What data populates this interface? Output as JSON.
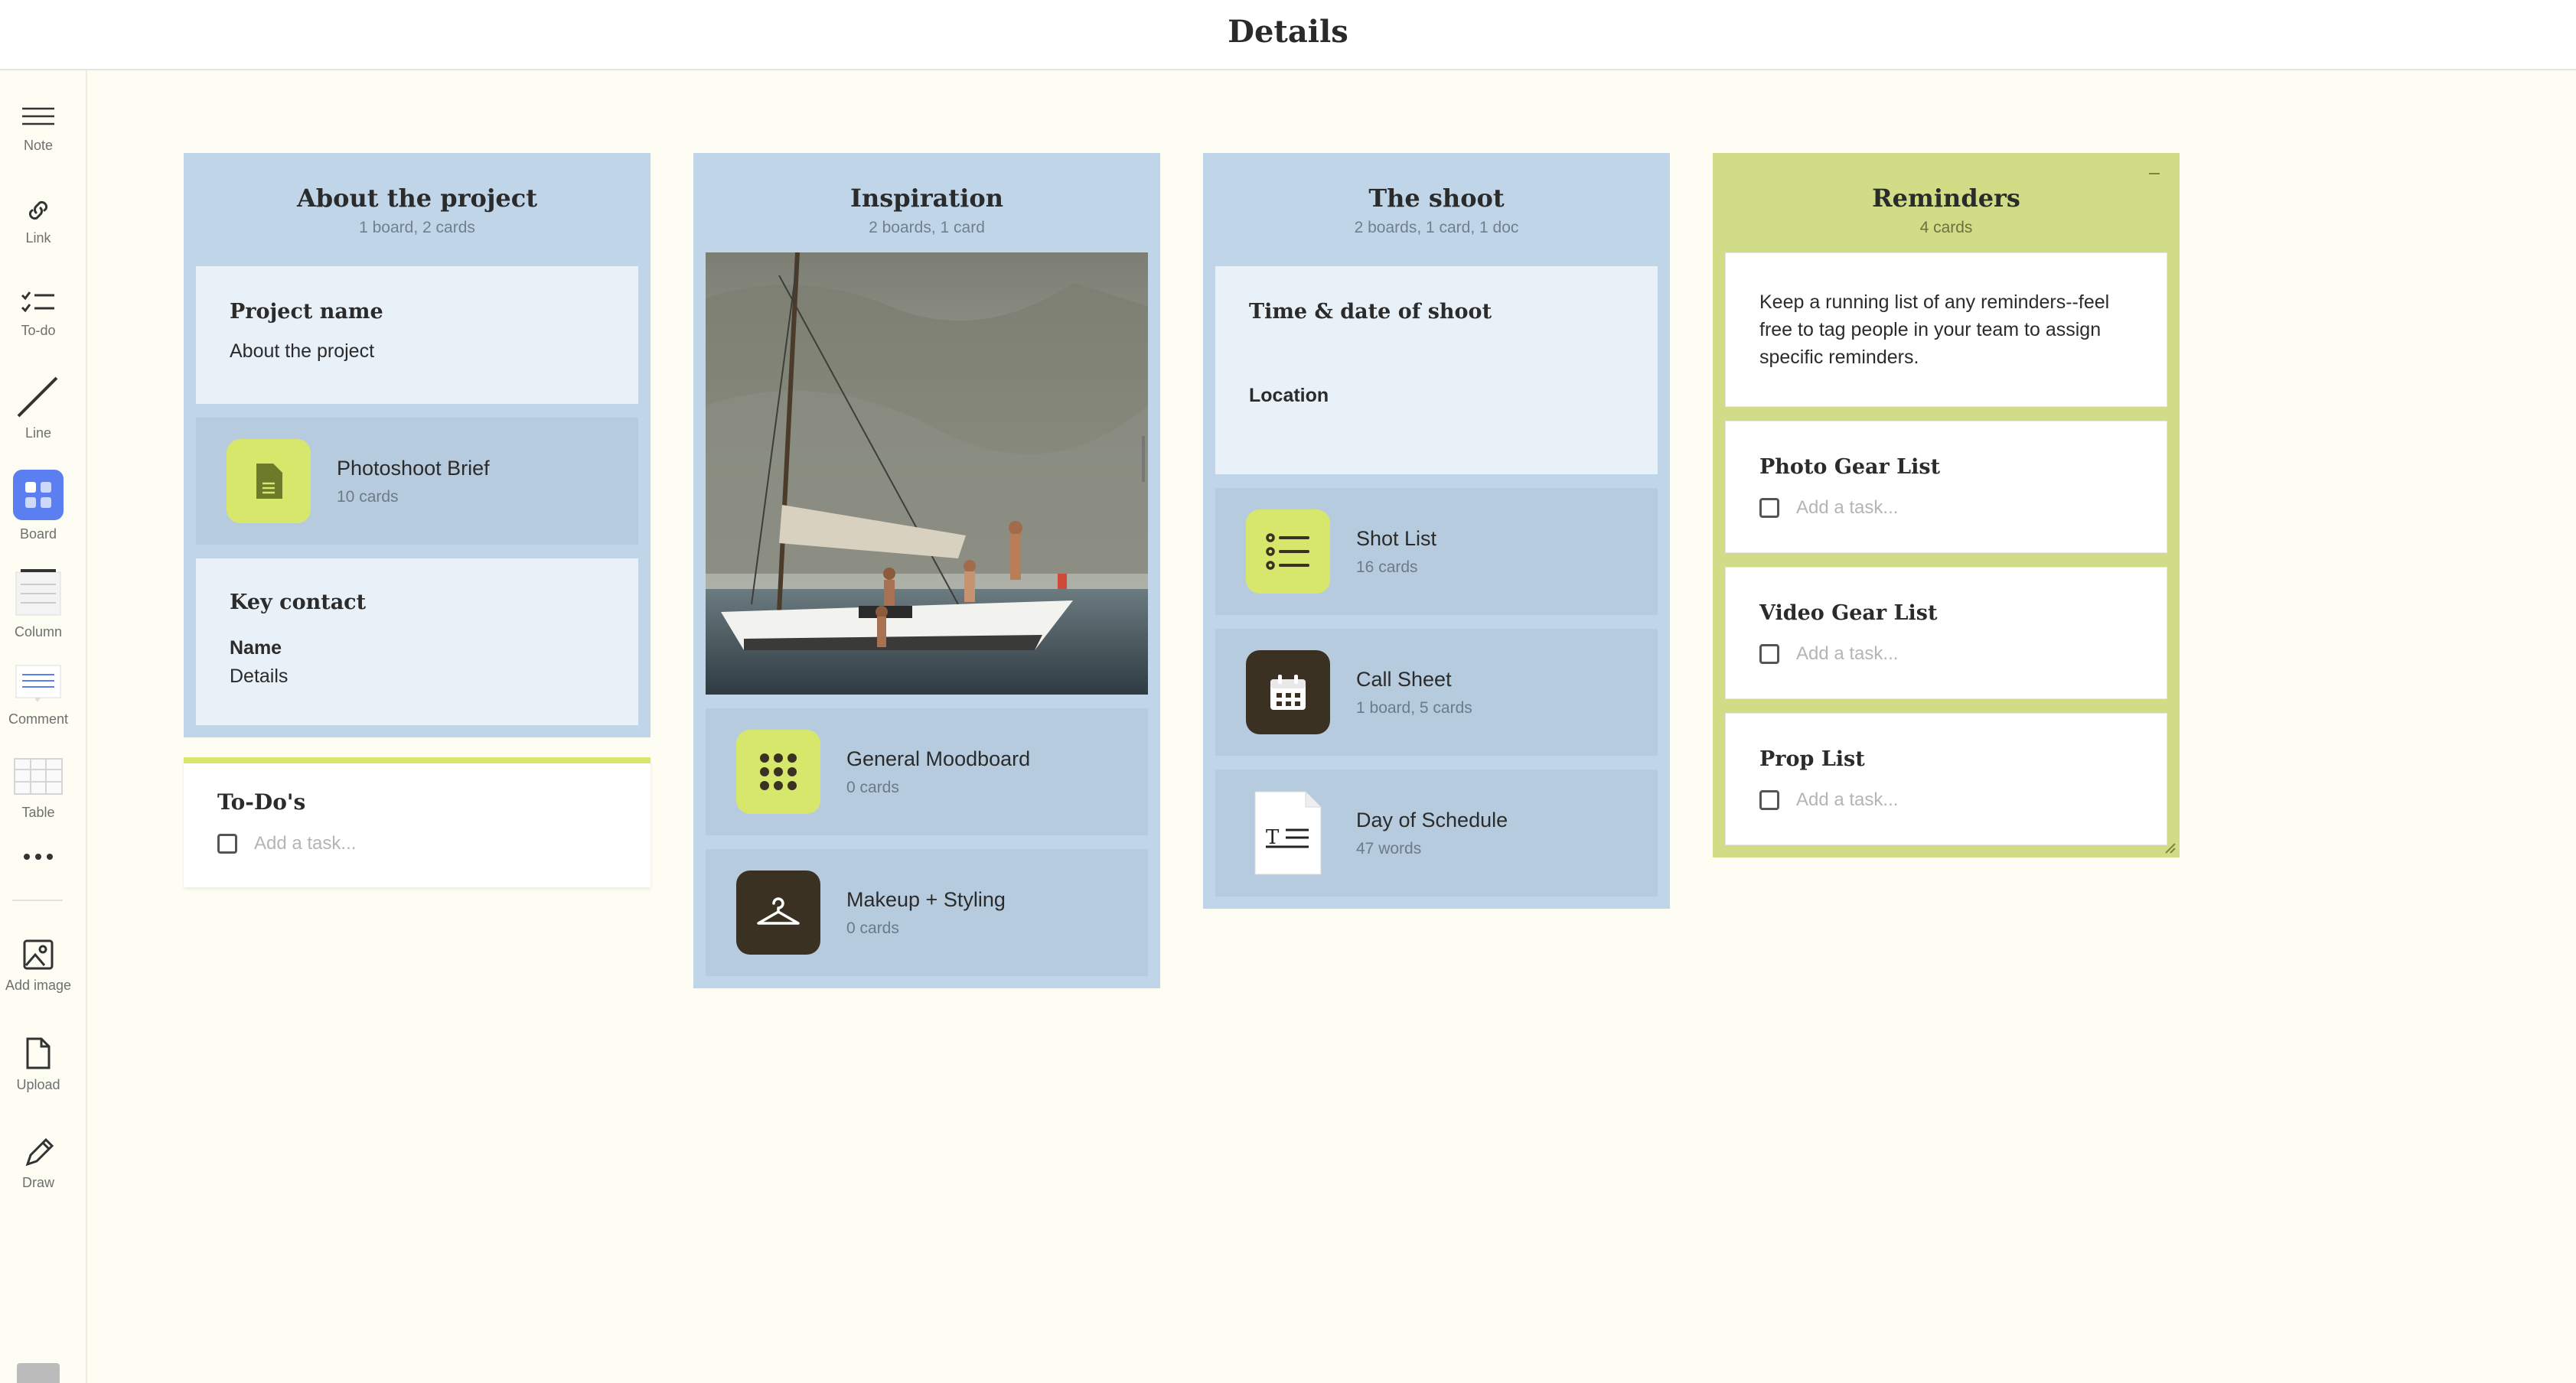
{
  "header": {
    "title": "Details"
  },
  "sidebar": {
    "tools": [
      {
        "label": "Note",
        "icon": "note-icon"
      },
      {
        "label": "Link",
        "icon": "link-icon"
      },
      {
        "label": "To-do",
        "icon": "todo-icon"
      },
      {
        "label": "Line",
        "icon": "line-icon"
      },
      {
        "label": "Board",
        "icon": "board-icon"
      },
      {
        "label": "Column",
        "icon": "column-icon"
      },
      {
        "label": "Comment",
        "icon": "comment-icon"
      },
      {
        "label": "Table",
        "icon": "table-icon"
      },
      {
        "label": "",
        "icon": "more-icon"
      },
      {
        "label": "Add image",
        "icon": "image-icon"
      },
      {
        "label": "Upload",
        "icon": "upload-icon"
      },
      {
        "label": "Draw",
        "icon": "pencil-icon"
      }
    ]
  },
  "columns": {
    "about": {
      "title": "About the project",
      "subtitle": "1 board, 2 cards",
      "project_card": {
        "title": "Project name",
        "body": "About the project"
      },
      "brief": {
        "title": "Photoshoot Brief",
        "sub": "10 cards"
      },
      "contact": {
        "title": "Key contact",
        "name_label": "Name",
        "details": "Details"
      }
    },
    "inspiration": {
      "title": "Inspiration",
      "subtitle": "2 boards, 1 card",
      "moodboard": {
        "title": "General Moodboard",
        "sub": "0 cards"
      },
      "makeup": {
        "title": "Makeup + Styling",
        "sub": "0 cards"
      }
    },
    "shoot": {
      "title": "The shoot",
      "subtitle": "2 boards, 1 card, 1 doc",
      "time_card": {
        "title": "Time & date of shoot",
        "location": "Location"
      },
      "shotlist": {
        "title": "Shot List",
        "sub": "16 cards"
      },
      "callsheet": {
        "title": "Call Sheet",
        "sub": "1 board, 5 cards"
      },
      "schedule": {
        "title": "Day of Schedule",
        "sub": "47 words"
      }
    },
    "reminders": {
      "title": "Reminders",
      "subtitle": "4 cards",
      "intro": "Keep a running list of any reminders--feel free to tag people in your team to assign specific reminders.",
      "lists": [
        {
          "title": "Photo Gear List",
          "placeholder": "Add a task..."
        },
        {
          "title": "Video Gear List",
          "placeholder": "Add a task..."
        },
        {
          "title": "Prop List",
          "placeholder": "Add a task..."
        }
      ]
    }
  },
  "todo": {
    "title": "To-Do's",
    "placeholder": "Add a task..."
  },
  "colors": {
    "background": "#fdfdf3",
    "column_blue": "#c0d5e8",
    "column_green": "#d1dc87",
    "accent_lime": "#d7e76b",
    "board_blue": "#5b7ff0",
    "dark_tile": "#3a3123"
  }
}
